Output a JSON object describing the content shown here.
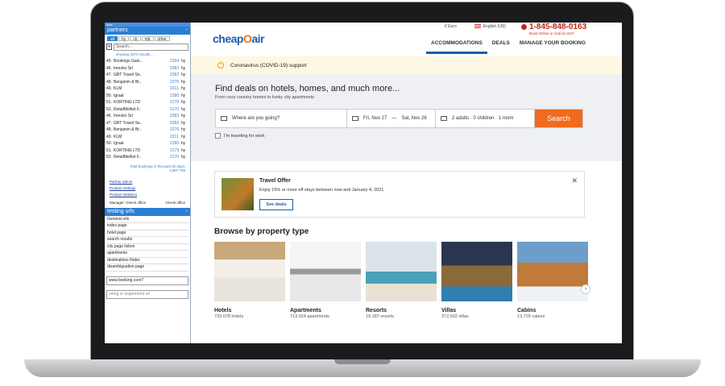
{
  "sidepanel": {
    "topbar": "hide",
    "partners_title": "partners",
    "collapse": "-",
    "tabs": [
      {
        "label": "all",
        "active": true
      },
      {
        "label": "hy"
      },
      {
        "label": "cb"
      },
      {
        "label": "mb"
      },
      {
        "label": "other"
      }
    ],
    "search_placeholder": "Search...",
    "showing": "showing 2972 results...",
    "rows": [
      {
        "num": "45.",
        "name": "Bookings Galo..",
        "val": "2294",
        "unit": "hy"
      },
      {
        "num": "46.",
        "name": "Imnoko Srl",
        "val": "2283",
        "unit": "hy"
      },
      {
        "num": "47.",
        "name": "GBT Travel Se..",
        "val": "2282",
        "unit": "hy"
      },
      {
        "num": "48.",
        "name": "Benjamin & Br..",
        "val": "2276",
        "unit": "hy"
      },
      {
        "num": "49.",
        "name": "KLM",
        "val": "2211",
        "unit": "hy"
      },
      {
        "num": "50.",
        "name": "Igraal",
        "val": "2180",
        "unit": "hy"
      },
      {
        "num": "51.",
        "name": "KORTING LTD",
        "val": "2179",
        "unit": "hy"
      },
      {
        "num": "52.",
        "name": "RetailMeNot F..",
        "val": "2170",
        "unit": "hy"
      },
      {
        "num": "46.",
        "name": "Imnoko Srl",
        "val": "2283",
        "unit": "hy"
      },
      {
        "num": "47.",
        "name": "GBT Travel Se..",
        "val": "2282",
        "unit": "hy"
      },
      {
        "num": "48.",
        "name": "Benjamin & Br..",
        "val": "2276",
        "unit": "hy"
      },
      {
        "num": "49.",
        "name": "KLM",
        "val": "2211",
        "unit": "hy"
      },
      {
        "num": "50.",
        "name": "Igraal",
        "val": "2180",
        "unit": "hy"
      },
      {
        "num": "51.",
        "name": "KORTING LTD",
        "val": "2179",
        "unit": "hy"
      },
      {
        "num": "52.",
        "name": "RetailMeNot F..",
        "val": "2170",
        "unit": "hy"
      }
    ],
    "total_line1": "Total bookings in the past 30 days:",
    "total_line2": "1,987,765",
    "links": [
      "Partner admin",
      "Product settings",
      "Product statistics"
    ],
    "manager": "Manager: Check office",
    "manager_right": "Check office",
    "testing_title": "testing urls",
    "urls": [
      "General urls",
      "index page",
      "hotel page",
      "search results",
      "city page lisbon",
      "apartments",
      "destinations finder",
      "disambiguation page"
    ],
    "field_value": "www.booking.com?",
    "field_placeholder": "string or experiment url"
  },
  "header": {
    "logo_part1": "cheap",
    "logo_part2": "O",
    "logo_part3": "air",
    "currency": "Euro",
    "language": "English (US)",
    "phone": "1-845-848-0163",
    "phone_sub": "Book Online or Call Us 24/7",
    "nav": [
      {
        "label": "ACCOMMODATIONS",
        "active": true
      },
      {
        "label": "DEALS"
      },
      {
        "label": "MANAGE YOUR BOOKING"
      }
    ]
  },
  "covid": {
    "text": "Coronavirus (COVID-19) support"
  },
  "hero": {
    "title": "Find deals on hotels, homes, and much more...",
    "subtitle": "From cozy country homes to funky city apartments",
    "where_placeholder": "Where are you going?",
    "checkin": "Fri, Nov 27",
    "dash": "—",
    "checkout": "Sat, Nov 28",
    "guests": "2 adults · 0 children · 1 room",
    "search_label": "Search",
    "work_label": "I'm traveling for work"
  },
  "offer": {
    "title": "Travel Offer",
    "text": "Enjoy 15% or more off stays between now and January 4, 2021.",
    "button": "See deals",
    "close": "✕"
  },
  "browse": {
    "title": "Browse by property type",
    "cards": [
      {
        "name": "Hotels",
        "count": "733 078 hotels",
        "cls": "hotels"
      },
      {
        "name": "Apartments",
        "count": "713,924 apartments",
        "cls": "apartments"
      },
      {
        "name": "Resorts",
        "count": "19,187 resorts",
        "cls": "resorts"
      },
      {
        "name": "Villas",
        "count": "372,602 villas",
        "cls": "villas"
      },
      {
        "name": "Cabins",
        "count": "13,729 cabins",
        "cls": "cabins"
      }
    ],
    "next": "›"
  }
}
